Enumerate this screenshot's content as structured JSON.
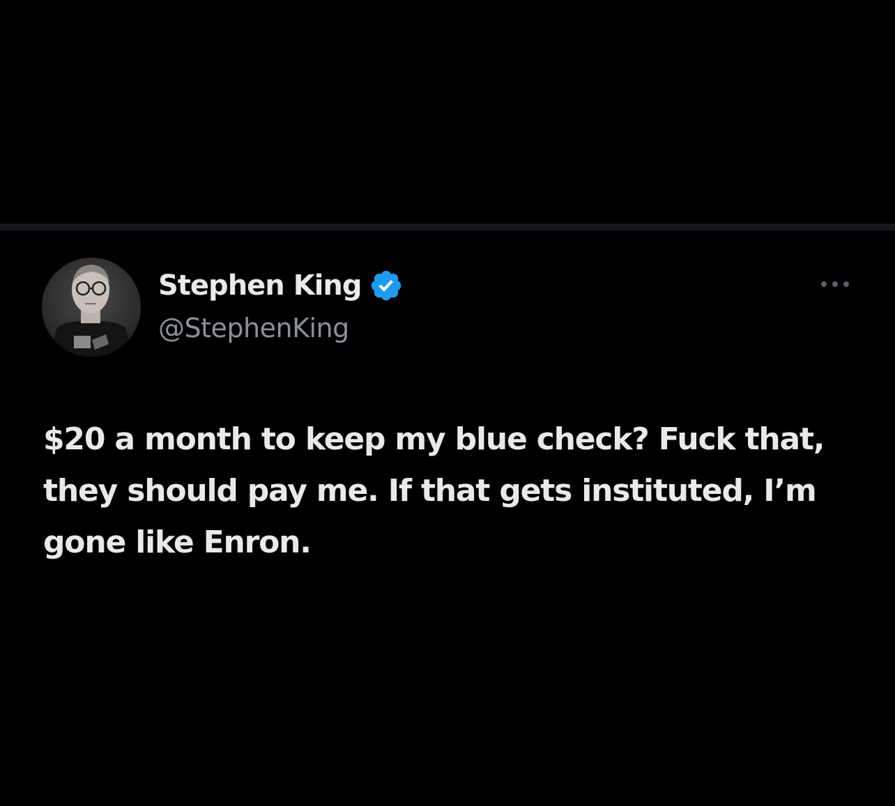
{
  "tweet": {
    "author": {
      "display_name": "Stephen King",
      "handle": "@StephenKing",
      "verified_icon": "verified-badge-icon",
      "avatar_icon": "profile-photo"
    },
    "more_icon": "more-options-icon",
    "text": "$20 a month to keep my blue check? Fuck that, they should pay me. If that gets instituted, I’m gone like Enron."
  },
  "colors": {
    "background": "#000000",
    "divider": "#16181c",
    "primary_text": "#e7e9ea",
    "secondary_text": "#8b9197",
    "verified_blue": "#1d9bf0"
  }
}
